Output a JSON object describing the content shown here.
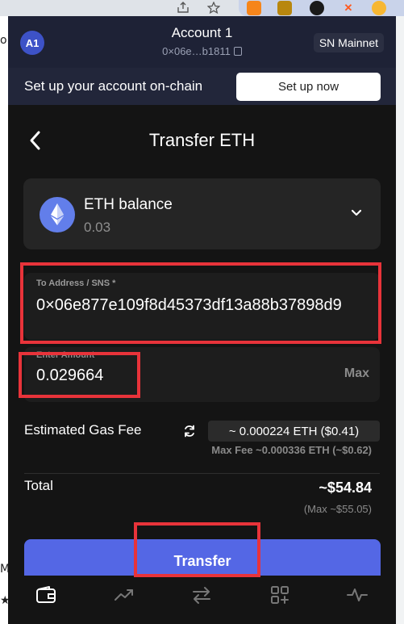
{
  "browser": {
    "toolbar_icons": [
      "share-icon",
      "star-icon"
    ],
    "extensions": [
      "metamask-icon",
      "extension-icon",
      "extension-icon",
      "extension-icon",
      "extension-icon"
    ]
  },
  "account": {
    "avatar_initials": "A1",
    "name": "Account 1",
    "address_short": "0×06e…b1811",
    "network": "SN Mainnet"
  },
  "banner": {
    "text": "Set up your account on-chain",
    "button_label": "Set up now"
  },
  "page": {
    "title": "Transfer ETH"
  },
  "token": {
    "name": "ETH balance",
    "balance": "0.03"
  },
  "recipient": {
    "label": "To Address / SNS *",
    "value": "0×06e877e109f8d45373df13a88b37898d9"
  },
  "amount": {
    "label": "Enter Amount",
    "value": "0.029664",
    "max_label": "Max"
  },
  "gas": {
    "label": "Estimated Gas Fee",
    "value": "~ 0.000224 ETH ($0.41)",
    "max_fee": "Max Fee ~0.000336 ETH (~$0.62)"
  },
  "total": {
    "label": "Total",
    "value": "~$54.84",
    "max": "(Max ~$55.05)"
  },
  "actions": {
    "transfer_label": "Transfer"
  },
  "nav": [
    "wallet-icon",
    "chart-icon",
    "swap-icon",
    "apps-icon",
    "activity-icon"
  ],
  "colors": {
    "accent": "#5467e5",
    "highlight": "#e8333a",
    "popup_bg": "#141414",
    "header_bg": "#1e2236"
  }
}
